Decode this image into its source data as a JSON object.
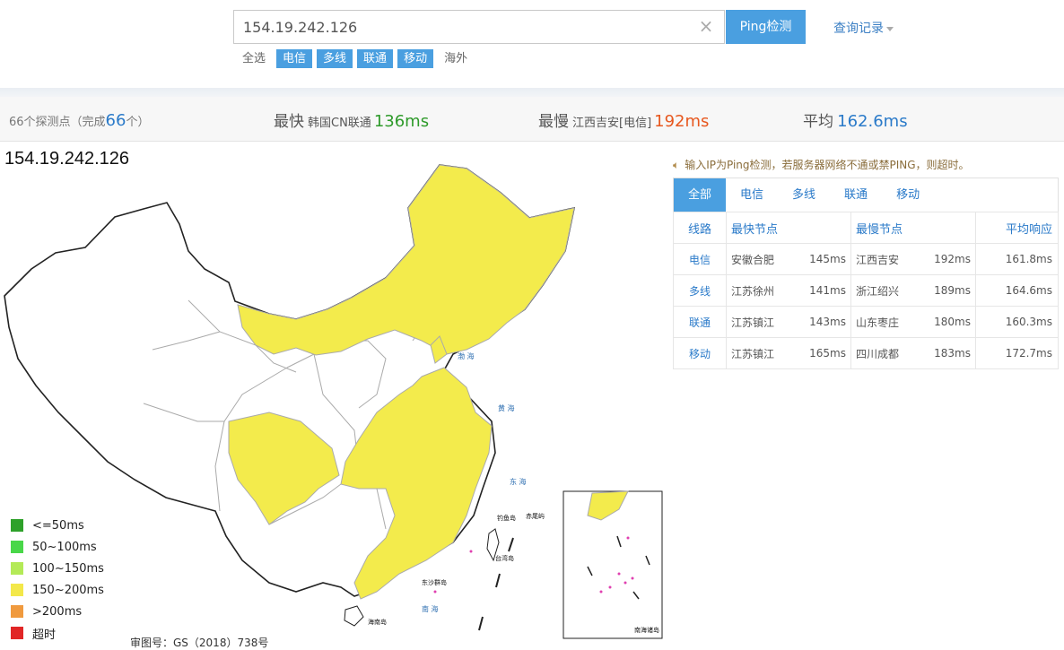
{
  "search": {
    "value": "154.19.242.126",
    "ping_label": "Ping检测",
    "history_label": "查询记录"
  },
  "filters": {
    "all": "全选",
    "telecom": "电信",
    "multi": "多线",
    "unicom": "联通",
    "mobile": "移动",
    "overseas": "海外"
  },
  "stats": {
    "probe_prefix": "66个探测点（完成",
    "probe_done": "66",
    "probe_suffix": "个）",
    "fastest_label": "最快",
    "fastest_loc": "韩国CN联通",
    "fastest_ms": "136ms",
    "slowest_label": "最慢",
    "slowest_loc": "江西吉安[电信]",
    "slowest_ms": "192ms",
    "avg_label": "平均",
    "avg_ms": "162.6ms"
  },
  "map": {
    "ip_title": "154.19.242.126",
    "review_no": "审图号：GS（2018）738号",
    "legend": [
      {
        "label": "<=50ms",
        "color": "#2ea12a"
      },
      {
        "label": "50~100ms",
        "color": "#49d749"
      },
      {
        "label": "100~150ms",
        "color": "#b4ea57"
      },
      {
        "label": "150~200ms",
        "color": "#f3e84a"
      },
      {
        "label": ">200ms",
        "color": "#f09a3e"
      },
      {
        "label": "超时",
        "color": "#e12626"
      }
    ],
    "province_fill": "#f3eb4c",
    "sea_labels": {
      "bohai": "渤 海",
      "huanghai": "黄 海",
      "donghai": "东 海",
      "nanhai": "南 海",
      "taiwan": "台湾岛",
      "hainan": "海南岛",
      "diaoyu": "钓鱼岛",
      "chiwei": "赤尾屿",
      "dongsha": "东沙群岛",
      "inset_title": "南海诸岛"
    }
  },
  "notice": "输入IP为Ping检测，若服务器网络不通或禁PING，则超时。",
  "tabs": [
    "全部",
    "电信",
    "多线",
    "联通",
    "移动"
  ],
  "table": {
    "headers": {
      "line": "线路",
      "fastest": "最快节点",
      "slowest": "最慢节点",
      "avg": "平均响应"
    },
    "rows": [
      {
        "line": "电信",
        "fast_city": "安徽合肥",
        "fast_ms": "145ms",
        "slow_city": "江西吉安",
        "slow_ms": "192ms",
        "avg": "161.8ms"
      },
      {
        "line": "多线",
        "fast_city": "江苏徐州",
        "fast_ms": "141ms",
        "slow_city": "浙江绍兴",
        "slow_ms": "189ms",
        "avg": "164.6ms"
      },
      {
        "line": "联通",
        "fast_city": "江苏镇江",
        "fast_ms": "143ms",
        "slow_city": "山东枣庄",
        "slow_ms": "180ms",
        "avg": "160.3ms"
      },
      {
        "line": "移动",
        "fast_city": "江苏镇江",
        "fast_ms": "165ms",
        "slow_city": "四川成都",
        "slow_ms": "183ms",
        "avg": "172.7ms"
      }
    ]
  }
}
